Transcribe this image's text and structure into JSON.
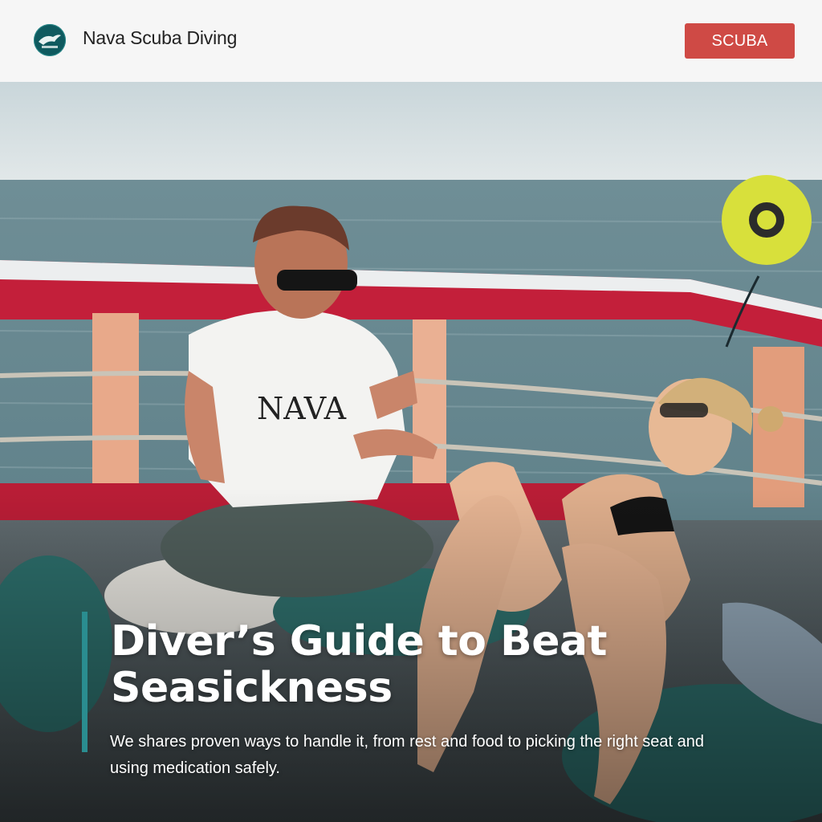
{
  "header": {
    "logo_icon": "nava-logo-icon",
    "brand_name": "Nava Scuba Diving",
    "cta_label": "SCUBA",
    "cta_color": "#cf4a45"
  },
  "hero": {
    "image_icon": "boat-deck-photo",
    "title": "Diver’s Guide to Beat Seasickness",
    "subtitle": "We shares proven ways to handle it, from rest and food to picking the right seat and using medication safely.",
    "accent_color": "#2a8d90"
  }
}
